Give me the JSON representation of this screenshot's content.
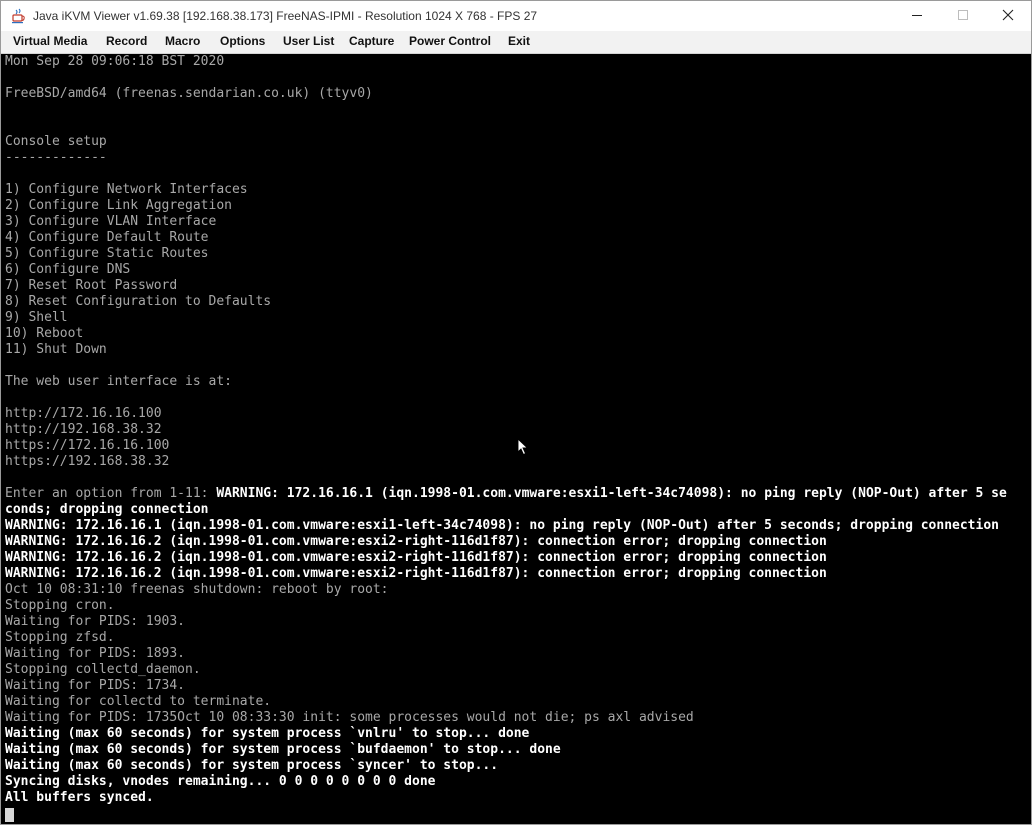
{
  "window": {
    "title": "Java iKVM Viewer v1.69.38 [192.168.38.173]  FreeNAS-IPMI  - Resolution 1024 X 768 - FPS 27"
  },
  "menu": {
    "items": [
      "Virtual Media",
      "Record",
      "Macro",
      "Options",
      "User List",
      "Capture",
      "Power Control",
      "Exit"
    ]
  },
  "console": {
    "lines": [
      {
        "text": "Mon Sep 28 09:06:18 BST 2020"
      },
      {
        "text": "FreeBSD/amd64 (freenas.sendarian.co.uk) (ttyv0)"
      },
      {
        "text": "Console setup"
      },
      {
        "text": "-------------"
      },
      {
        "text": "1) Configure Network Interfaces"
      },
      {
        "text": "2) Configure Link Aggregation"
      },
      {
        "text": "3) Configure VLAN Interface"
      },
      {
        "text": "4) Configure Default Route"
      },
      {
        "text": "5) Configure Static Routes"
      },
      {
        "text": "6) Configure DNS"
      },
      {
        "text": "7) Reset Root Password"
      },
      {
        "text": "8) Reset Configuration to Defaults"
      },
      {
        "text": "9) Shell"
      },
      {
        "text": "10) Reboot"
      },
      {
        "text": "11) Shut Down"
      },
      {
        "text": "The web user interface is at:"
      },
      {
        "text": "http://172.16.16.100"
      },
      {
        "text": "http://192.168.38.32"
      },
      {
        "text": "https://172.16.16.100"
      },
      {
        "text": "https://192.168.38.32"
      },
      {
        "prefix": "Enter an option from 1-11: ",
        "text": "WARNING: 172.16.16.1 (iqn.1998-01.com.vmware:esxi1-left-34c74098): no ping reply (NOP-Out) after 5 se"
      },
      {
        "text": "conds; dropping connection"
      },
      {
        "text": "WARNING: 172.16.16.1 (iqn.1998-01.com.vmware:esxi1-left-34c74098): no ping reply (NOP-Out) after 5 seconds; dropping connection"
      },
      {
        "text": "WARNING: 172.16.16.2 (iqn.1998-01.com.vmware:esxi2-right-116d1f87): connection error; dropping connection"
      },
      {
        "text": "WARNING: 172.16.16.2 (iqn.1998-01.com.vmware:esxi2-right-116d1f87): connection error; dropping connection"
      },
      {
        "text": "WARNING: 172.16.16.2 (iqn.1998-01.com.vmware:esxi2-right-116d1f87): connection error; dropping connection"
      },
      {
        "text": "Oct 10 08:31:10 freenas shutdown: reboot by root:"
      },
      {
        "text": "Stopping cron."
      },
      {
        "text": "Waiting for PIDS: 1903."
      },
      {
        "text": "Stopping zfsd."
      },
      {
        "text": "Waiting for PIDS: 1893."
      },
      {
        "text": "Stopping collectd_daemon."
      },
      {
        "text": "Waiting for PIDS: 1734."
      },
      {
        "text": "Waiting for collectd to terminate."
      },
      {
        "text": "Waiting for PIDS: 1735Oct 10 08:33:30 init: some processes would not die; ps axl advised"
      },
      {
        "text": "Waiting (max 60 seconds) for system process `vnlru' to stop... done"
      },
      {
        "text": "Waiting (max 60 seconds) for system process `bufdaemon' to stop... done"
      },
      {
        "text": "Waiting (max 60 seconds) for system process `syncer' to stop..."
      },
      {
        "text": "Syncing disks, vnodes remaining... 0 0 0 0 0 0 0 0 done"
      },
      {
        "text": "All buffers synced."
      }
    ]
  },
  "colors": {
    "console_bg": "#000000",
    "console_normal": "#a8a8a8",
    "console_bright": "#ffffff",
    "menubar_bg": "#f2f2f2"
  }
}
